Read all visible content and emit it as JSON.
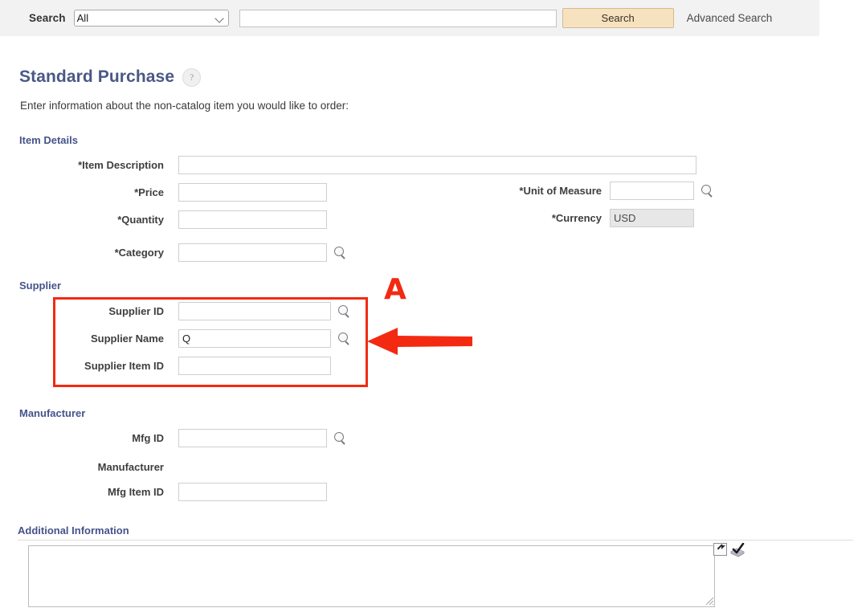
{
  "search": {
    "label": "Search",
    "scope_selected": "All",
    "scope_options": [
      "All"
    ],
    "query_value": "",
    "query_placeholder": "",
    "button_label": "Search",
    "advanced_link": "Advanced Search"
  },
  "page": {
    "title": "Standard Purchase",
    "help_icon": "?",
    "subtitle": "Enter information about the non-catalog item you would like to order:"
  },
  "sections": {
    "item_details": {
      "heading": "Item Details",
      "fields": [
        {
          "label": "*Item Description",
          "value": "",
          "lookup": false
        },
        {
          "label": "*Price",
          "value": "",
          "lookup": false
        },
        {
          "label": "*Quantity",
          "value": "",
          "lookup": false
        },
        {
          "label": "*Category",
          "value": "",
          "lookup": true
        },
        {
          "label": "*Unit of Measure",
          "value": "",
          "lookup": true
        },
        {
          "label": "*Currency",
          "value": "USD",
          "lookup": false,
          "disabled": true
        }
      ]
    },
    "supplier": {
      "heading": "Supplier",
      "fields": [
        {
          "label": "Supplier ID",
          "value": "",
          "lookup": true
        },
        {
          "label": "Supplier Name",
          "value": "Q",
          "lookup": true
        },
        {
          "label": "Supplier Item ID",
          "value": "",
          "lookup": false
        }
      ]
    },
    "manufacturer": {
      "heading": "Manufacturer",
      "fields": [
        {
          "label": "Mfg ID",
          "value": "",
          "lookup": true
        },
        {
          "label": "Manufacturer",
          "value": "",
          "lookup": false
        },
        {
          "label": "Mfg Item ID",
          "value": "",
          "lookup": false
        }
      ]
    },
    "additional_information": {
      "heading": "Additional Information",
      "value": "",
      "placeholder": ""
    }
  },
  "annotations": {
    "marker_letter": "A",
    "marker_color": "#f32a11",
    "arrow_direction": "left",
    "highlight_border_color": "#f32a11",
    "highlight_target": "Supplier"
  },
  "icons": {
    "lookup": "magnifier-icon",
    "expand": "expand-textarea-icon",
    "spellcheck": "spellcheck-icon",
    "dropdown": "chevron-down-icon"
  }
}
